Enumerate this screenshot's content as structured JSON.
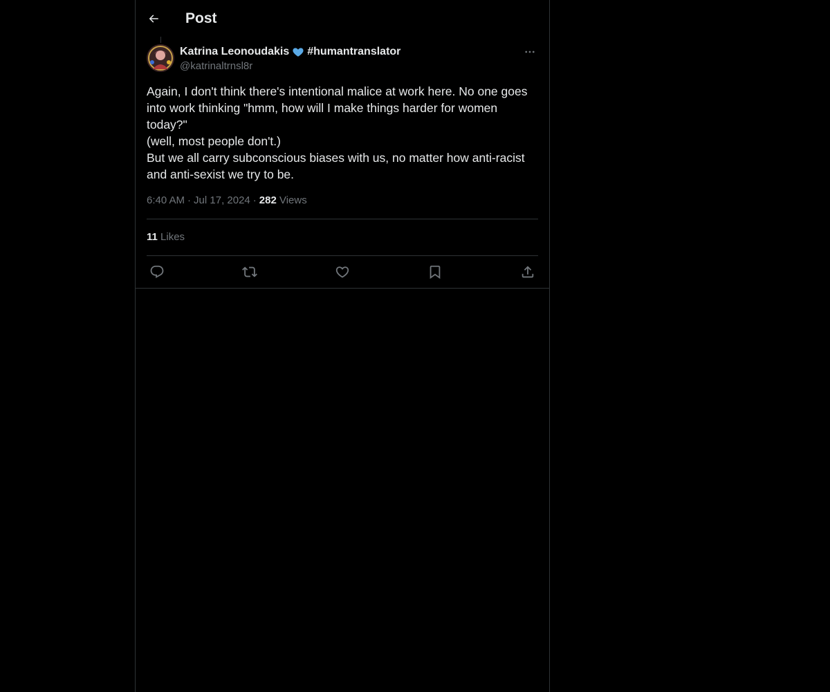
{
  "colors": {
    "background": "#000000",
    "text_primary": "#e7e9ea",
    "text_secondary": "#71767b",
    "border": "#2f3336",
    "heart_blue": "#5aa9e6"
  },
  "header": {
    "back_icon": "arrow-left-icon",
    "title": "Post"
  },
  "post": {
    "author": {
      "name": "Katrina Leonoudakis",
      "badge_icon": "blue-heart-emoji",
      "hashtag": "#humantranslator",
      "handle": "@katrinaltrnsl8r"
    },
    "more_icon": "ellipsis-icon",
    "text_lines": [
      "Again, I don't think there's intentional malice at work here. No one goes into work thinking \"hmm, how will I make things harder for women today?\"",
      "(well, most people don't.)",
      "But we all carry subconscious biases with us, no matter how anti-racist and anti-sexist we try to be."
    ],
    "time": "6:40 AM",
    "date": "Jul 17, 2024",
    "views_count": "282",
    "views_label": "Views",
    "likes_count": "11",
    "likes_label": "Likes"
  },
  "actions": [
    {
      "name": "reply",
      "icon": "reply-icon"
    },
    {
      "name": "repost",
      "icon": "repost-icon"
    },
    {
      "name": "like",
      "icon": "heart-icon"
    },
    {
      "name": "bookmark",
      "icon": "bookmark-icon"
    },
    {
      "name": "share",
      "icon": "share-icon"
    }
  ]
}
